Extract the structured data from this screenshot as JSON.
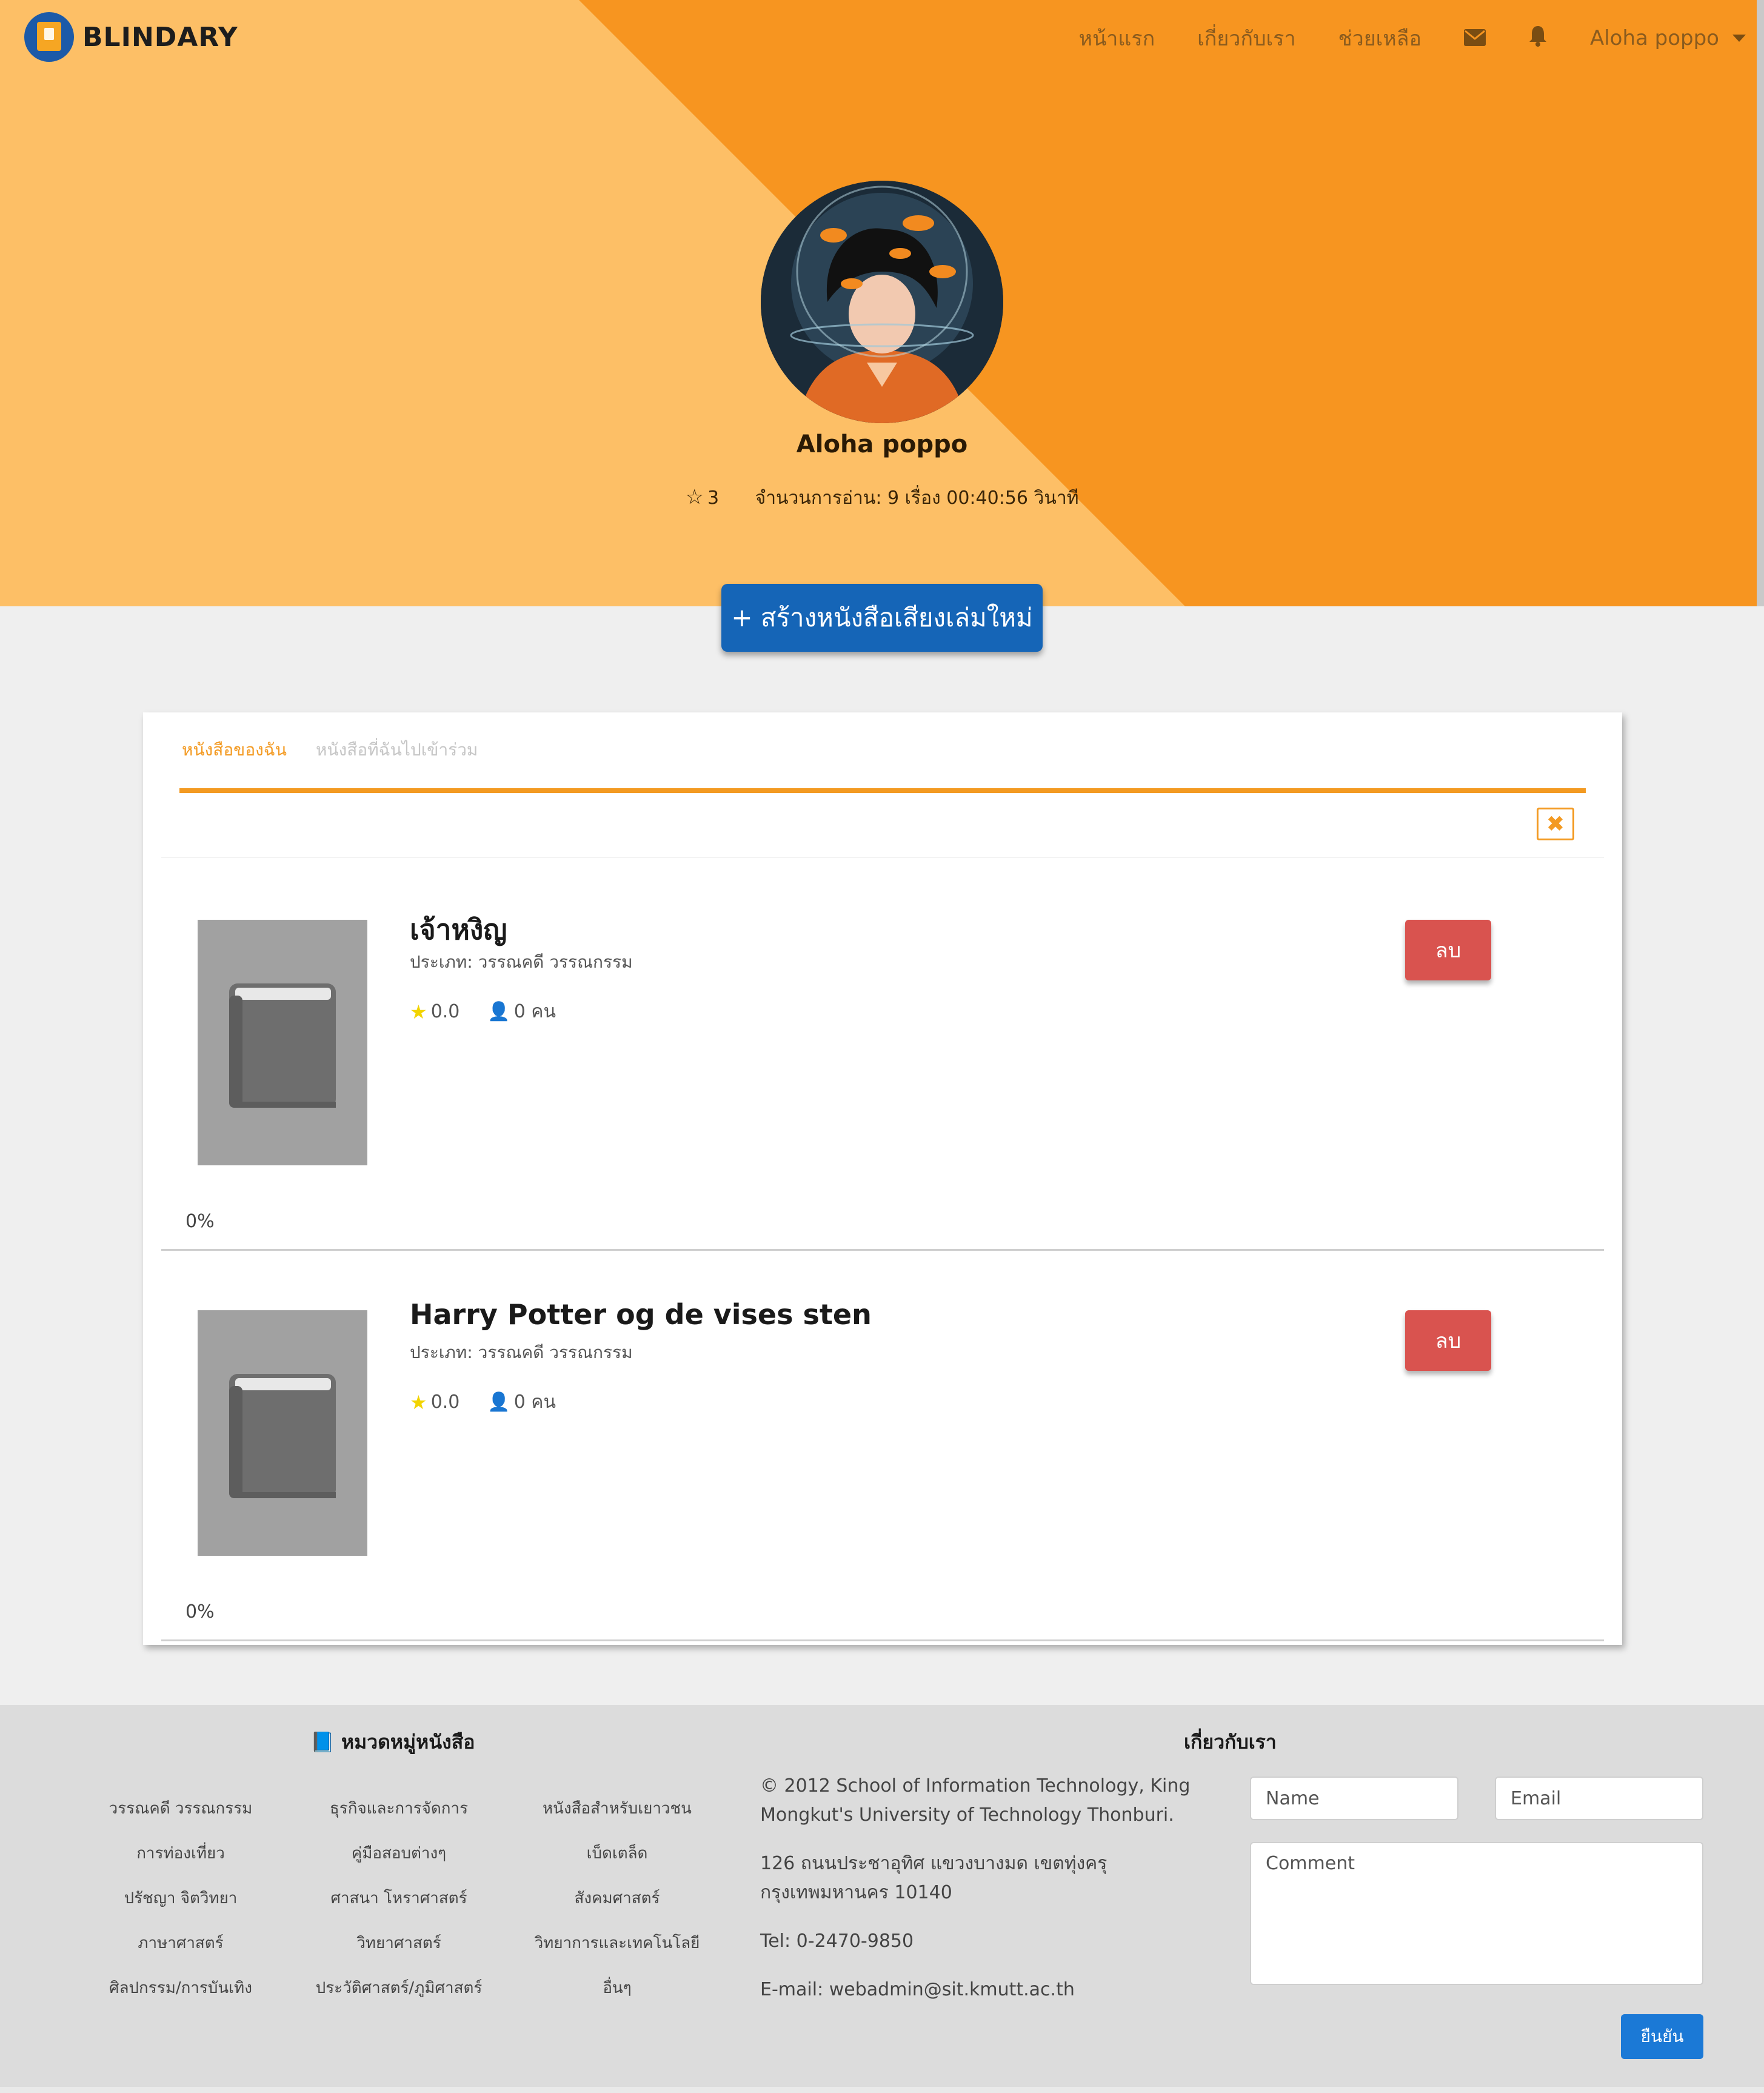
{
  "brand": {
    "name": "BLINDARY"
  },
  "nav": {
    "links": [
      "หน้าแรก",
      "เกี่ยวกับเรา",
      "ช่วยเหลือ"
    ],
    "mail_icon": "envelope-icon",
    "bell_icon": "bell-icon",
    "user": "Aloha poppo"
  },
  "profile": {
    "name": "Aloha poppo",
    "stars": "3",
    "reading_stats": "จำนวนการอ่าน: 9 เรื่อง 00:40:56 วินาที"
  },
  "create_button": "+ สร้างหนังสือเสียงเล่มใหม่",
  "tabs": [
    "หนังสือของฉัน",
    "หนังสือที่ฉันไปเข้าร่วม"
  ],
  "close_icon": "close-icon",
  "books": [
    {
      "title": "เจ้าหงิญ",
      "category": "ประเภท: วรรณคดี วรรณกรรม",
      "rating": "0.0",
      "users": "0 คน",
      "delete_label": "ลบ",
      "progress": "0%"
    },
    {
      "title": "Harry Potter og de vises sten",
      "category": "ประเภท: วรรณคดี วรรณกรรม",
      "rating": "0.0",
      "users": "0 คน",
      "delete_label": "ลบ",
      "progress": "0%"
    }
  ],
  "footer": {
    "categories_title": "หมวดหมู่หนังสือ",
    "categories": [
      "วรรณคดี วรรณกรรม",
      "ธุรกิจและการจัดการ",
      "หนังสือสำหรับเยาวชน",
      "การท่องเที่ยว",
      "คู่มือสอบต่างๆ",
      "เบ็ดเตล็ด",
      "ปรัชญา จิตวิทยา",
      "ศาสนา โหราศาสตร์",
      "สังคมศาสตร์",
      "ภาษาศาสตร์",
      "วิทยาศาสตร์",
      "วิทยาการและเทคโนโลยี",
      "ศิลปกรรม/การบันเทิง",
      "ประวัติศาสตร์/ภูมิศาสตร์",
      "อื่นๆ"
    ],
    "about_title": "เกี่ยวกับเรา",
    "copyright": "© 2012 School of Information Technology, King Mongkut's University of Technology Thonburi.",
    "address": "126 ถนนประชาอุทิศ แขวงบางมด เขตทุ่งครุ กรุงเทพมหานคร 10140",
    "tel": "Tel: 0-2470-9850",
    "email": "E-mail: webadmin@sit.kmutt.ac.th",
    "form": {
      "name_placeholder": "Name",
      "email_placeholder": "Email",
      "comment_placeholder": "Comment",
      "submit": "ยืนยัน"
    }
  },
  "colors": {
    "orange_light": "#fdbf66",
    "orange": "#f79520",
    "blue": "#1565b7",
    "red": "#d9534f"
  }
}
